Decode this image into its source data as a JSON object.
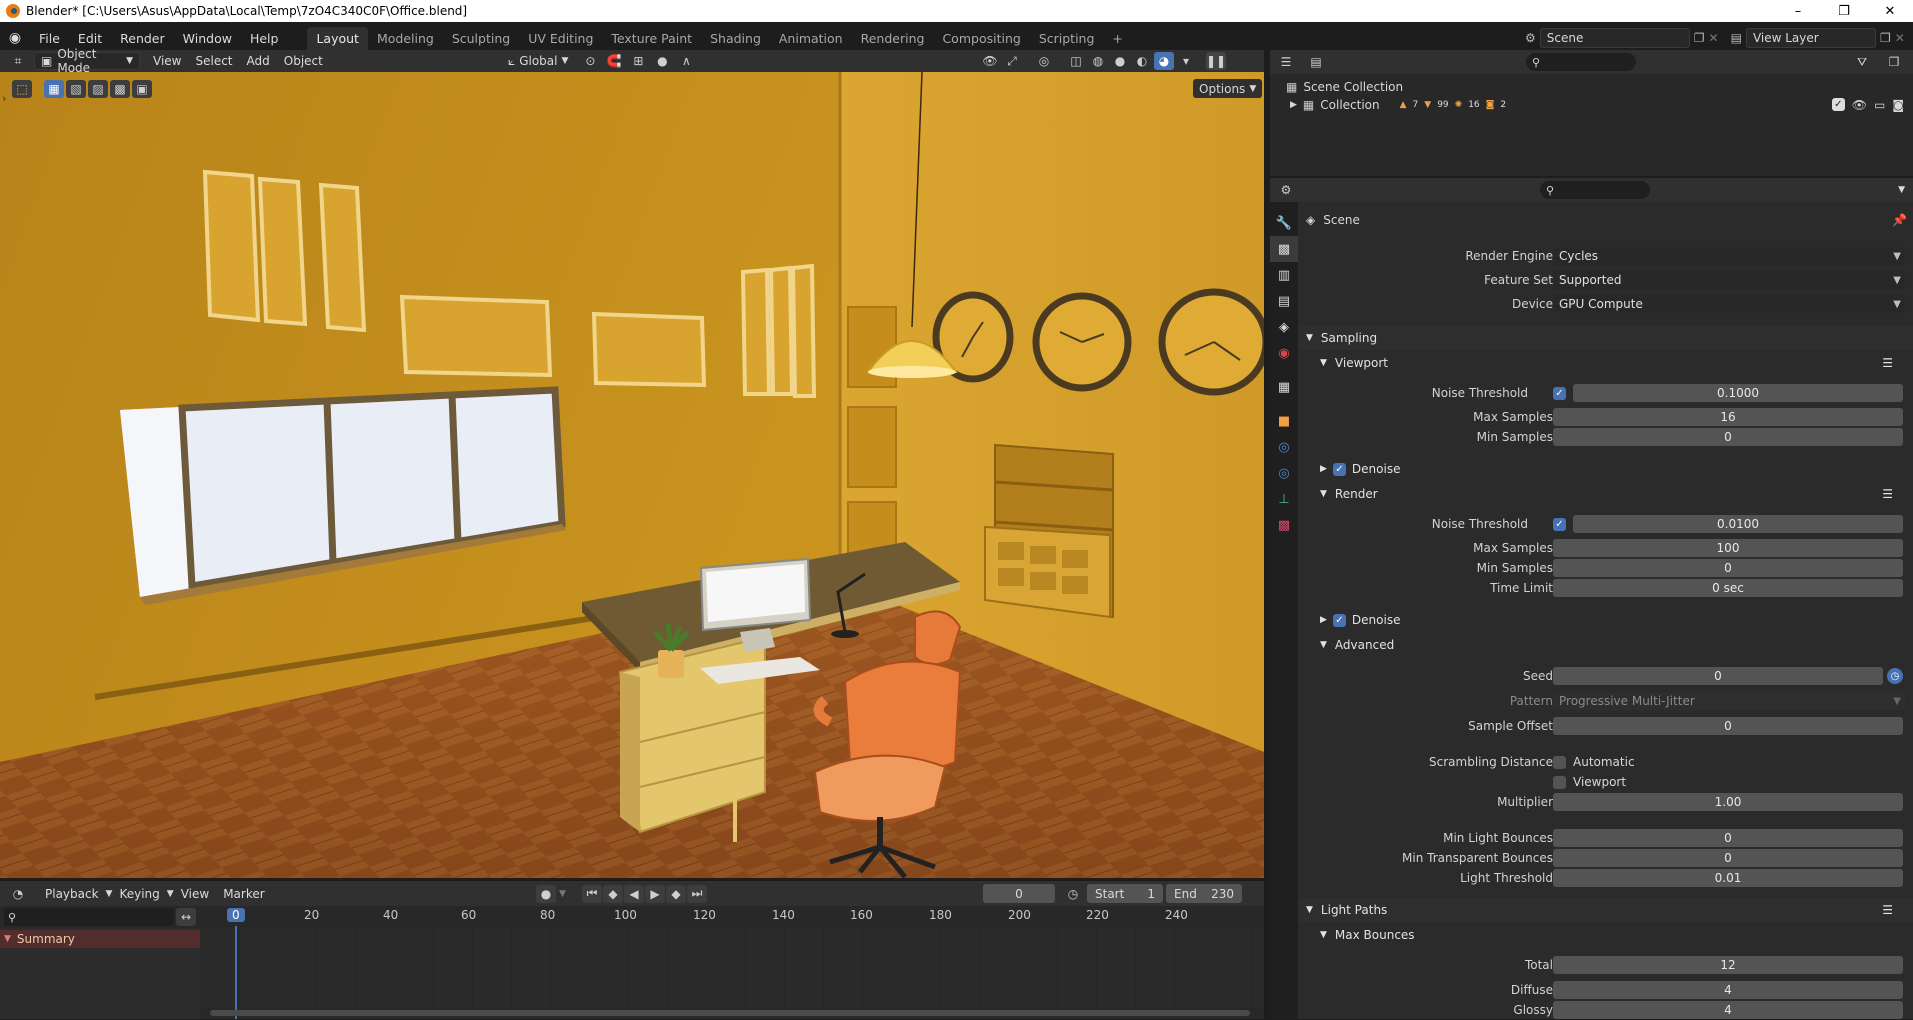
{
  "window": {
    "title": "Blender* [C:\\Users\\Asus\\AppData\\Local\\Temp\\7zO4C340C0F\\Office.blend]",
    "minimize": "–",
    "maximize": "❐",
    "close": "✕"
  },
  "menu": [
    "File",
    "Edit",
    "Render",
    "Window",
    "Help"
  ],
  "workspaces": [
    "Layout",
    "Modeling",
    "Sculpting",
    "UV Editing",
    "Texture Paint",
    "Shading",
    "Animation",
    "Rendering",
    "Compositing",
    "Scripting",
    "+"
  ],
  "scene_field": "Scene",
  "view_layer_field": "View Layer",
  "viewport_header": {
    "mode": "Object Mode",
    "items": [
      "View",
      "Select",
      "Add",
      "Object"
    ],
    "transform": "Global",
    "options": "Options"
  },
  "timeline": {
    "menus": [
      "Playback",
      "Keying",
      "View",
      "Marker"
    ],
    "current_frame": "0",
    "start_label": "Start",
    "start_value": "1",
    "end_label": "End",
    "end_value": "230",
    "ruler": [
      "0",
      "20",
      "40",
      "60",
      "80",
      "100",
      "120",
      "140",
      "160",
      "180",
      "200",
      "220",
      "240"
    ],
    "summary": "Summary"
  },
  "outliner": {
    "scene_collection": "Scene Collection",
    "collection": "Collection",
    "counts": [
      "7",
      "99",
      "16",
      "2"
    ]
  },
  "properties": {
    "context": "Scene",
    "render_engine_label": "Render Engine",
    "render_engine": "Cycles",
    "feature_set_label": "Feature Set",
    "feature_set": "Supported",
    "device_label": "Device",
    "device": "GPU Compute",
    "sampling": "Sampling",
    "viewport": "Viewport",
    "noise_threshold_label": "Noise Threshold",
    "vp_noise_threshold": "0.1000",
    "max_samples_label": "Max Samples",
    "vp_max_samples": "16",
    "min_samples_label": "Min Samples",
    "vp_min_samples": "0",
    "denoise": "Denoise",
    "render": "Render",
    "r_noise_threshold": "0.0100",
    "r_max_samples": "100",
    "r_min_samples": "0",
    "time_limit_label": "Time Limit",
    "r_time_limit": "0 sec",
    "advanced": "Advanced",
    "seed_label": "Seed",
    "seed": "0",
    "pattern_label": "Pattern",
    "pattern": "Progressive Multi-Jitter",
    "sample_offset_label": "Sample Offset",
    "sample_offset": "0",
    "scrambling_label": "Scrambling Distance",
    "automatic": "Automatic",
    "viewport_opt": "Viewport",
    "multiplier_label": "Multiplier",
    "multiplier": "1.00",
    "min_light_bounces_label": "Min Light Bounces",
    "min_light_bounces": "0",
    "min_transparent_label": "Min Transparent Bounces",
    "min_transparent": "0",
    "light_threshold_label": "Light Threshold",
    "light_threshold": "0.01",
    "light_paths": "Light Paths",
    "max_bounces": "Max Bounces",
    "total_label": "Total",
    "total": "12",
    "diffuse_label": "Diffuse",
    "diffuse": "4",
    "glossy_label": "Glossy",
    "glossy": "4"
  },
  "colors": {
    "accent": "#4772b3",
    "bg_dark": "#1d1d1d",
    "panel": "#2b2b2b",
    "wall": "#c5901c",
    "chair": "#e67a3a"
  }
}
